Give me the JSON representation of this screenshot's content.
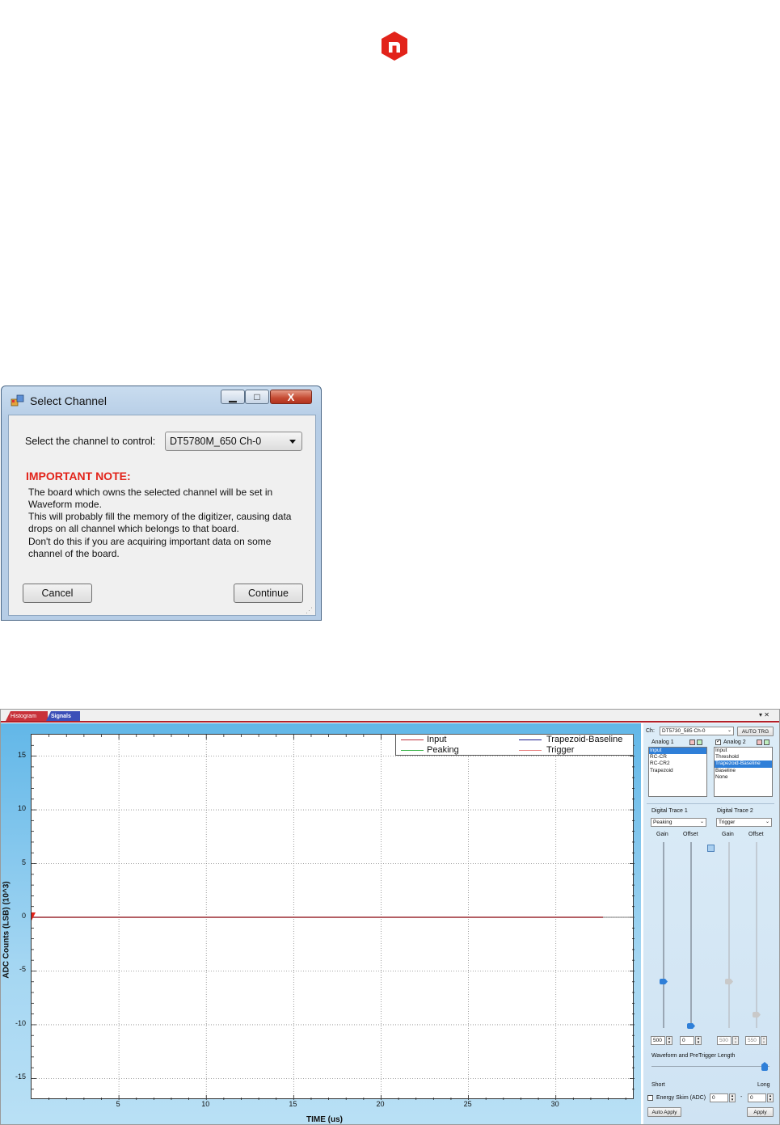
{
  "dialog": {
    "title": "Select Channel",
    "prompt_label": "Select the channel to control:",
    "channel_selected": "DT5780M_650  Ch-0",
    "note_title": "IMPORTANT NOTE:",
    "note_lines": [
      "The board which owns the selected channel will be set in",
      "Waveform mode.",
      "This will probably fill the memory of the digitizer, causing data",
      "drops on all channel which belongs to that board.",
      "Don't do this if you are acquiring important data on some",
      "channel of the board."
    ],
    "cancel_label": "Cancel",
    "continue_label": "Continue",
    "close_glyph": "X"
  },
  "app": {
    "tabs": [
      "Histogram",
      "Signals"
    ],
    "active_tab": "Signals",
    "tab_controls": "▾ ✕",
    "panel": {
      "ch_label": "Ch:",
      "ch_value": "DT5730_585  Ch-0",
      "auto_trg_label": "AUTO TRG",
      "analog1_label": "Analog 1",
      "analog2_label": "Analog 2",
      "analog1_options": [
        "Input",
        "RC-CR",
        "RC-CR2",
        "Trapezoid"
      ],
      "analog1_selected": "Input",
      "analog2_options": [
        "Input",
        "Threshold",
        "Trapezoid-Baseline",
        "Baseline",
        "None"
      ],
      "analog2_selected": "Trapezoid-Baseline",
      "digital1_label": "Digital Trace 1",
      "digital2_label": "Digital Trace 2",
      "digital1_value": "Peaking",
      "digital2_value": "Trigger",
      "gain_label": "Gain",
      "offset_label": "Offset",
      "gain1_value": "500",
      "offset1_value": "0",
      "gain2_value": "500",
      "offset2_value": "550",
      "waveform_label": "Waveform and PreTrigger Length",
      "short_label": "Short",
      "long_label": "Long",
      "energy_skim_label": "Energy Skim (ADC)",
      "energy_min": "0",
      "energy_dash": "-",
      "energy_max": "0",
      "auto_apply_label": "Auto Apply",
      "apply_label": "Apply",
      "colors": {
        "red": "#e0323a",
        "green": "#3cb44b",
        "highlight": "#2f7fd8"
      }
    }
  },
  "chart_data": {
    "type": "line",
    "xlabel": "TIME (us)",
    "ylabel": "ADC Counts (LSB) (10^3)",
    "xlim": [
      0,
      34.5
    ],
    "ylim": [
      -17,
      17
    ],
    "xticks": [
      5,
      10,
      15,
      20,
      25,
      30
    ],
    "yticks": [
      15,
      10,
      5,
      0,
      -5,
      -10,
      -15
    ],
    "grid": true,
    "legend_position": "top-right",
    "series": [
      {
        "name": "Input",
        "color": "#c0303a",
        "x": [
          0,
          32.7
        ],
        "y": [
          0,
          0
        ]
      },
      {
        "name": "Peaking",
        "color": "#3cb44b",
        "x": [
          0,
          32.7
        ],
        "y": [
          0,
          0
        ]
      },
      {
        "name": "Trapezoid-Baseline",
        "color": "#1a1a8c",
        "x": [
          0,
          32.7
        ],
        "y": [
          0,
          0
        ]
      },
      {
        "name": "Trigger",
        "color": "#e88080",
        "x": [
          0,
          32.7
        ],
        "y": [
          0,
          0
        ]
      }
    ]
  }
}
